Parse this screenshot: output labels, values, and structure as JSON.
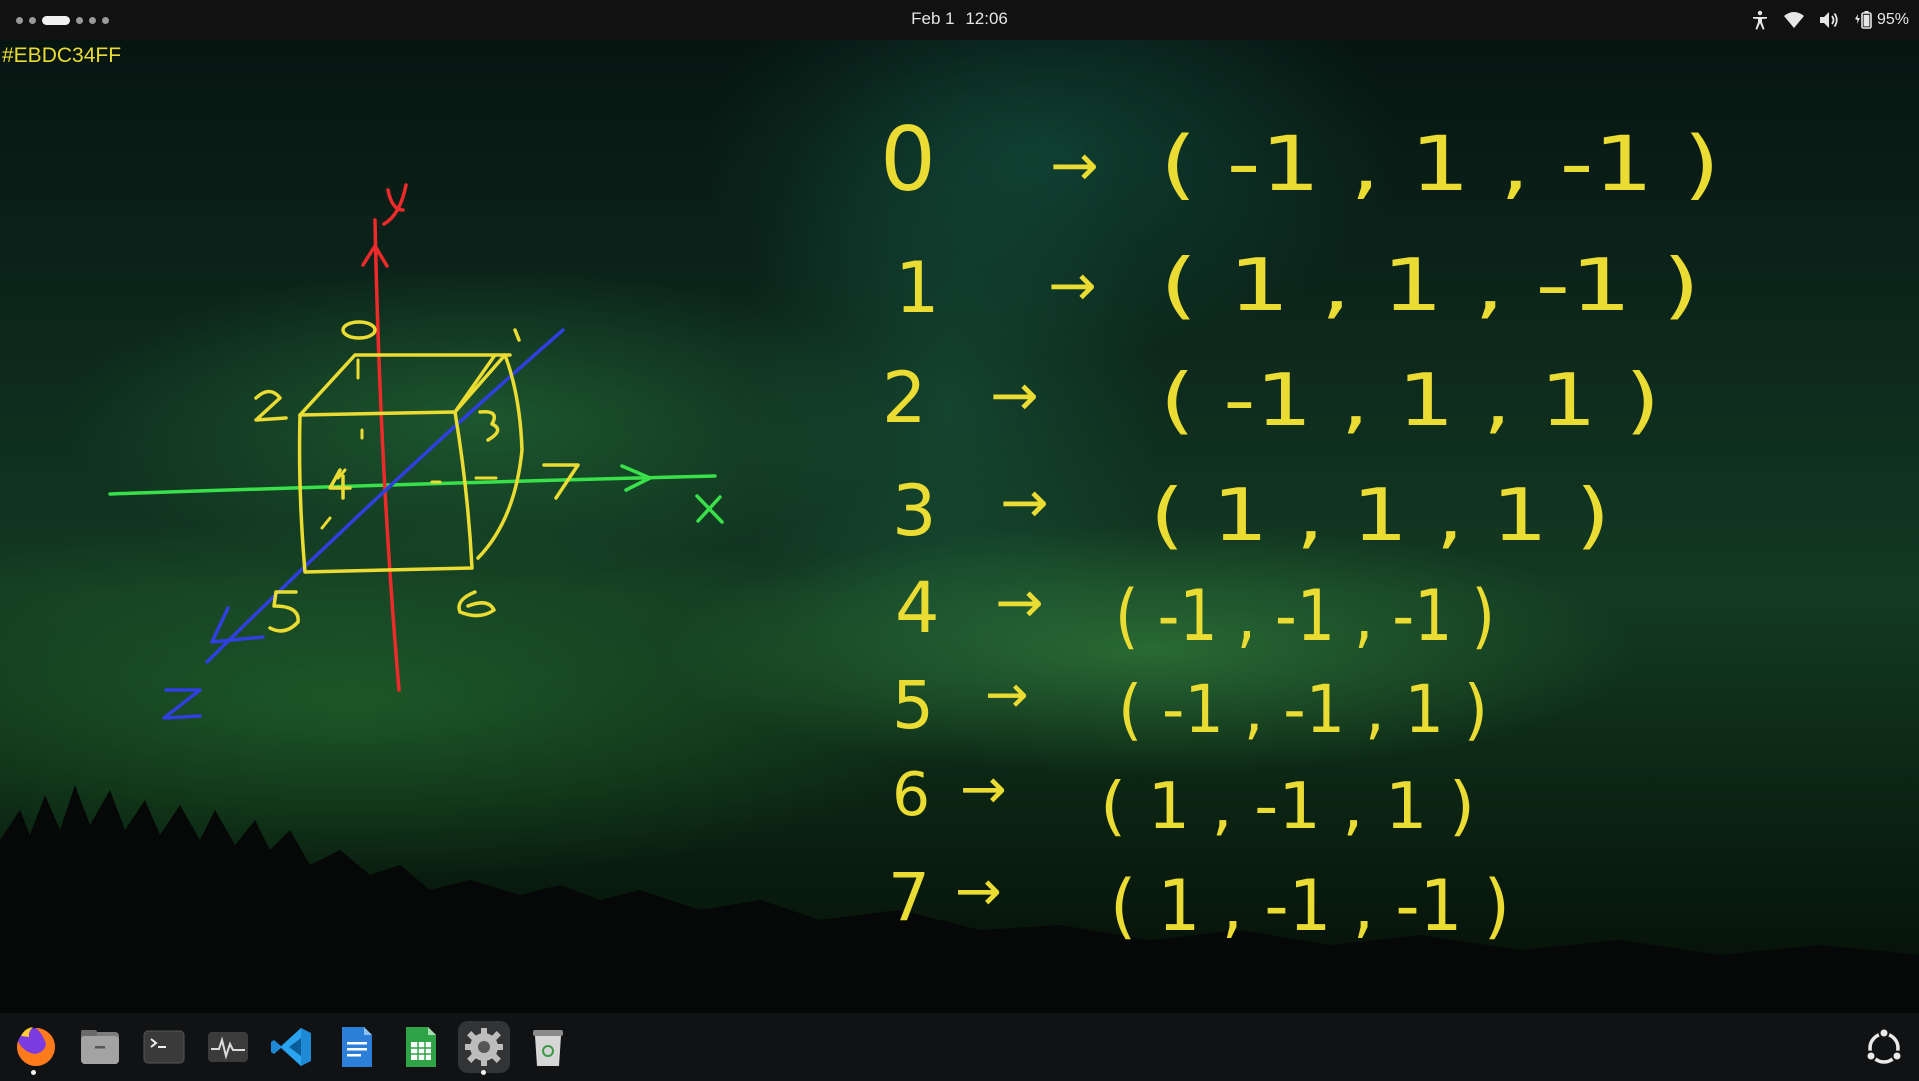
{
  "topbar": {
    "date": "Feb 1",
    "time": "12:06",
    "battery_percent": "95%",
    "workspace_count": 6,
    "active_workspace": 3,
    "icons": [
      "accessibility-icon",
      "wifi-icon",
      "volume-icon",
      "battery-icon"
    ]
  },
  "overlay": {
    "color_label": "#EBDC34FF",
    "stroke_color": "#EBDC34"
  },
  "diagram": {
    "axis_y": "y",
    "axis_x": "x",
    "axis_z": "z",
    "axis_colors": {
      "x": "#39e04a",
      "y": "#ee2a2a",
      "z": "#2f3fe0"
    },
    "vertex_labels": [
      "0",
      "1",
      "2",
      "3",
      "4",
      "5",
      "6",
      "7"
    ]
  },
  "mapping": [
    {
      "index": "0",
      "arrow": "→",
      "tuple": "( -1 , 1 , -1 )"
    },
    {
      "index": "1",
      "arrow": "→",
      "tuple": "( 1 , 1 , -1 )"
    },
    {
      "index": "2",
      "arrow": "→",
      "tuple": "( -1 , 1 , 1 )"
    },
    {
      "index": "3",
      "arrow": "→",
      "tuple": "( 1 , 1 , 1 )"
    },
    {
      "index": "4",
      "arrow": "→",
      "tuple": "( -1 , -1 , -1 )"
    },
    {
      "index": "5",
      "arrow": "→",
      "tuple": "( -1 , -1 , 1 )"
    },
    {
      "index": "6",
      "arrow": "→",
      "tuple": "( 1 , -1 , 1 )"
    },
    {
      "index": "7",
      "arrow": "→",
      "tuple": "( 1 , -1 , -1 )"
    }
  ],
  "dock": {
    "apps": [
      {
        "name": "firefox",
        "icon": "firefox-icon",
        "running": true
      },
      {
        "name": "files",
        "icon": "files-icon",
        "running": false
      },
      {
        "name": "terminal",
        "icon": "terminal-icon",
        "running": false
      },
      {
        "name": "system-monitor",
        "icon": "system-monitor-icon",
        "running": false
      },
      {
        "name": "vscode",
        "icon": "vscode-icon",
        "running": false
      },
      {
        "name": "writer",
        "icon": "writer-icon",
        "running": false
      },
      {
        "name": "calc",
        "icon": "calc-icon",
        "running": false
      },
      {
        "name": "settings",
        "icon": "settings-icon",
        "running": true
      },
      {
        "name": "trash",
        "icon": "trash-icon",
        "running": false
      }
    ],
    "show_apps_icon": "show-apps-icon"
  }
}
